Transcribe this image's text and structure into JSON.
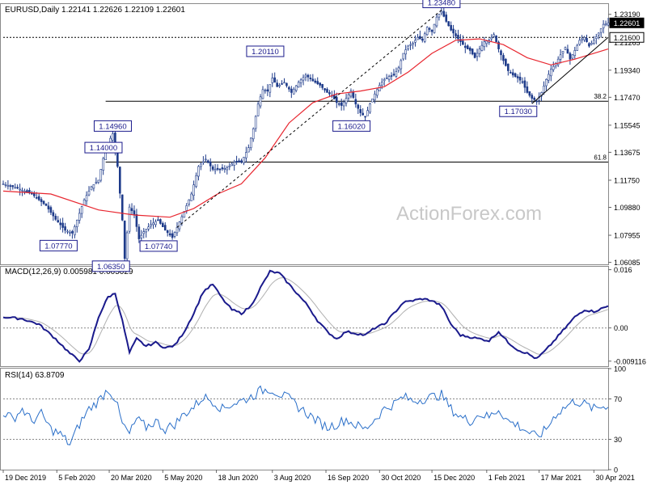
{
  "chart_data": [
    {
      "type": "candlestick",
      "title": "EURUSD,Daily",
      "ohlc_label": "1.22141 1.22626 1.22109 1.22601",
      "ylim": [
        1.0595,
        1.239
      ],
      "yticks": [
        "1.23190",
        "1.21265",
        "1.19340",
        "1.17470",
        "1.15545",
        "1.13675",
        "1.11750",
        "1.09880",
        "1.07955",
        "1.06085"
      ],
      "price_badges": [
        {
          "label": "1.22601",
          "value": 1.22601,
          "style": "dark"
        },
        {
          "label": "1.21600",
          "value": 1.216,
          "style": "light"
        }
      ],
      "price_path": [
        [
          0,
          1.115
        ],
        [
          6,
          1.112
        ],
        [
          12,
          1.108
        ],
        [
          18,
          1.1
        ],
        [
          22,
          1.0905
        ],
        [
          26,
          1.083
        ],
        [
          29,
          1.081
        ],
        [
          31,
          1.09
        ],
        [
          34,
          1.104
        ],
        [
          37,
          1.113
        ],
        [
          40,
          1.1175
        ],
        [
          43,
          1.14
        ],
        [
          46,
          1.1496
        ],
        [
          48,
          1.127
        ],
        [
          50,
          1.09
        ],
        [
          51,
          1.0635
        ],
        [
          53,
          1.099
        ],
        [
          55,
          1.094
        ],
        [
          57,
          1.077
        ],
        [
          59,
          1.082
        ],
        [
          62,
          1.087
        ],
        [
          65,
          1.09
        ],
        [
          68,
          1.083
        ],
        [
          71,
          1.078
        ],
        [
          73,
          1.085
        ],
        [
          76,
          1.096
        ],
        [
          79,
          1.108
        ],
        [
          82,
          1.127
        ],
        [
          85,
          1.132
        ],
        [
          88,
          1.125
        ],
        [
          91,
          1.125
        ],
        [
          94,
          1.126
        ],
        [
          97,
          1.13
        ],
        [
          100,
          1.13
        ],
        [
          103,
          1.14
        ],
        [
          105,
          1.153
        ],
        [
          107,
          1.17
        ],
        [
          109,
          1.18
        ],
        [
          111,
          1.179
        ],
        [
          113,
          1.188
        ],
        [
          115,
          1.182
        ],
        [
          118,
          1.185
        ],
        [
          121,
          1.178
        ],
        [
          124,
          1.185
        ],
        [
          127,
          1.19
        ],
        [
          130,
          1.186
        ],
        [
          133,
          1.183
        ],
        [
          136,
          1.178
        ],
        [
          138,
          1.176
        ],
        [
          140,
          1.171
        ],
        [
          142,
          1.169
        ],
        [
          144,
          1.174
        ],
        [
          146,
          1.179
        ],
        [
          148,
          1.17
        ],
        [
          150,
          1.164
        ],
        [
          152,
          1.161
        ],
        [
          154,
          1.1702
        ],
        [
          156,
          1.177
        ],
        [
          158,
          1.183
        ],
        [
          160,
          1.187
        ],
        [
          162,
          1.189
        ],
        [
          164,
          1.19
        ],
        [
          166,
          1.195
        ],
        [
          168,
          1.205
        ],
        [
          170,
          1.21
        ],
        [
          172,
          1.212
        ],
        [
          174,
          1.216
        ],
        [
          176,
          1.214
        ],
        [
          178,
          1.223
        ],
        [
          180,
          1.22
        ],
        [
          182,
          1.23
        ],
        [
          184,
          1.234
        ],
        [
          186,
          1.227
        ],
        [
          188,
          1.221
        ],
        [
          190,
          1.217
        ],
        [
          192,
          1.213
        ],
        [
          194,
          1.209
        ],
        [
          196,
          1.207
        ],
        [
          198,
          1.202
        ],
        [
          200,
          1.208
        ],
        [
          202,
          1.213
        ],
        [
          204,
          1.214
        ],
        [
          206,
          1.218
        ],
        [
          208,
          1.208
        ],
        [
          210,
          1.2
        ],
        [
          212,
          1.193
        ],
        [
          214,
          1.19
        ],
        [
          216,
          1.188
        ],
        [
          218,
          1.185
        ],
        [
          220,
          1.178
        ],
        [
          222,
          1.174
        ],
        [
          224,
          1.172
        ],
        [
          226,
          1.178
        ],
        [
          228,
          1.187
        ],
        [
          230,
          1.194
        ],
        [
          232,
          1.198
        ],
        [
          234,
          1.204
        ],
        [
          236,
          1.209
        ],
        [
          238,
          1.201
        ],
        [
          240,
          1.207
        ],
        [
          242,
          1.214
        ],
        [
          244,
          1.216
        ],
        [
          246,
          1.21
        ],
        [
          248,
          1.214
        ],
        [
          250,
          1.219
        ],
        [
          252,
          1.225
        ],
        [
          254,
          1.226
        ]
      ],
      "sma_path": [
        [
          0,
          1.11
        ],
        [
          20,
          1.108
        ],
        [
          40,
          1.097
        ],
        [
          55,
          1.0935
        ],
        [
          70,
          1.092
        ],
        [
          80,
          1.098
        ],
        [
          90,
          1.108
        ],
        [
          100,
          1.115
        ],
        [
          110,
          1.133
        ],
        [
          120,
          1.157
        ],
        [
          130,
          1.171
        ],
        [
          140,
          1.177
        ],
        [
          150,
          1.179
        ],
        [
          160,
          1.182
        ],
        [
          170,
          1.192
        ],
        [
          180,
          1.205
        ],
        [
          190,
          1.214
        ],
        [
          200,
          1.215
        ],
        [
          210,
          1.211
        ],
        [
          220,
          1.202
        ],
        [
          230,
          1.197
        ],
        [
          240,
          1.201
        ],
        [
          254,
          1.208
        ]
      ],
      "sma_color": "#e8262f",
      "candle_color": "#1e3b8a",
      "fib_levels": [
        {
          "label": "38.2",
          "value": 1.172,
          "x_from": 43
        },
        {
          "label": "61.8",
          "value": 1.13,
          "x_from": 43
        }
      ],
      "resistance_level": 1.216,
      "trendlines": [
        {
          "from": [
            73,
            1.085
          ],
          "to": [
            184,
            1.2348
          ],
          "dashed": true,
          "color": "#000000"
        },
        {
          "from": [
            222,
            1.1703
          ],
          "to": [
            254,
            1.216
          ],
          "dashed": false,
          "color": "#000000"
        }
      ],
      "price_labels": [
        {
          "label": "1.23480",
          "x": 184,
          "value": 1.2348,
          "pos": "above"
        },
        {
          "label": "1.20110",
          "x": 110,
          "value": 1.2011,
          "pos": "above"
        },
        {
          "label": "1.16020",
          "x": 152,
          "value": 1.1602,
          "pos": "below"
        },
        {
          "label": "1.17030",
          "x": 222,
          "value": 1.1703,
          "pos": "below"
        },
        {
          "label": "1.14960",
          "x": 46,
          "value": 1.1496,
          "pos": "above"
        },
        {
          "label": "1.14000",
          "x": 37,
          "value": 1.14,
          "pos": "right"
        },
        {
          "label": "1.07770",
          "x": 29,
          "value": 1.0777,
          "pos": "below"
        },
        {
          "label": "1.07740",
          "x": 71,
          "value": 1.0774,
          "pos": "below"
        },
        {
          "label": "1.06350",
          "x": 51,
          "value": 1.0635,
          "pos": "below"
        }
      ],
      "watermark": "ActionForex.com"
    },
    {
      "type": "line",
      "title": "MACD(12,26,9) 0.005981 0.005029",
      "ylim": [
        -0.0105,
        0.0168
      ],
      "yticks": [
        "0.016",
        "0.00",
        "-0.009116"
      ],
      "zero_label": "0.00",
      "macd_color": "#1a1a8c",
      "signal_color": "#b0b0b0",
      "macd_path": [
        [
          0,
          0.003
        ],
        [
          8,
          0.0025
        ],
        [
          15,
          0.001
        ],
        [
          22,
          -0.003
        ],
        [
          28,
          -0.007
        ],
        [
          32,
          -0.009
        ],
        [
          36,
          -0.006
        ],
        [
          40,
          0.003
        ],
        [
          44,
          0.0085
        ],
        [
          47,
          0.0095
        ],
        [
          50,
          0.002
        ],
        [
          53,
          -0.0068
        ],
        [
          56,
          -0.003
        ],
        [
          60,
          -0.005
        ],
        [
          64,
          -0.004
        ],
        [
          68,
          -0.0055
        ],
        [
          72,
          -0.0048
        ],
        [
          76,
          -0.001
        ],
        [
          80,
          0.004
        ],
        [
          84,
          0.01
        ],
        [
          88,
          0.012
        ],
        [
          92,
          0.008
        ],
        [
          96,
          0.005
        ],
        [
          100,
          0.004
        ],
        [
          104,
          0.006
        ],
        [
          108,
          0.011
        ],
        [
          112,
          0.0155
        ],
        [
          116,
          0.015
        ],
        [
          120,
          0.012
        ],
        [
          124,
          0.009
        ],
        [
          128,
          0.006
        ],
        [
          132,
          0.002
        ],
        [
          136,
          -0.001
        ],
        [
          140,
          -0.003
        ],
        [
          144,
          -0.001
        ],
        [
          148,
          -0.0015
        ],
        [
          152,
          -0.002
        ],
        [
          156,
          0.0
        ],
        [
          160,
          0.001
        ],
        [
          164,
          0.004
        ],
        [
          168,
          0.007
        ],
        [
          172,
          0.0075
        ],
        [
          176,
          0.008
        ],
        [
          180,
          0.0075
        ],
        [
          184,
          0.006
        ],
        [
          188,
          0.001
        ],
        [
          192,
          -0.002
        ],
        [
          196,
          -0.0025
        ],
        [
          200,
          -0.003
        ],
        [
          204,
          -0.0035
        ],
        [
          208,
          -0.001
        ],
        [
          212,
          -0.004
        ],
        [
          216,
          -0.006
        ],
        [
          220,
          -0.007
        ],
        [
          224,
          -0.0085
        ],
        [
          228,
          -0.006
        ],
        [
          232,
          -0.003
        ],
        [
          236,
          0.0
        ],
        [
          240,
          0.003
        ],
        [
          244,
          0.005
        ],
        [
          248,
          0.0045
        ],
        [
          252,
          0.0055
        ],
        [
          254,
          0.006
        ]
      ]
    },
    {
      "type": "line",
      "title": "RSI(14) 63.8709",
      "ylim": [
        0,
        100
      ],
      "yticks": [
        "100",
        "70",
        "30",
        "0"
      ],
      "levels": [
        70,
        30
      ],
      "line_color": "#2a6fc9",
      "rsi_path": [
        [
          0,
          57
        ],
        [
          4,
          50
        ],
        [
          8,
          60
        ],
        [
          12,
          48
        ],
        [
          16,
          55
        ],
        [
          20,
          40
        ],
        [
          24,
          35
        ],
        [
          28,
          25
        ],
        [
          32,
          45
        ],
        [
          36,
          60
        ],
        [
          40,
          68
        ],
        [
          44,
          80
        ],
        [
          47,
          70
        ],
        [
          50,
          45
        ],
        [
          53,
          35
        ],
        [
          56,
          50
        ],
        [
          60,
          42
        ],
        [
          64,
          48
        ],
        [
          68,
          40
        ],
        [
          72,
          45
        ],
        [
          76,
          55
        ],
        [
          80,
          62
        ],
        [
          84,
          72
        ],
        [
          88,
          68
        ],
        [
          92,
          60
        ],
        [
          96,
          65
        ],
        [
          100,
          68
        ],
        [
          104,
          72
        ],
        [
          108,
          78
        ],
        [
          112,
          80
        ],
        [
          116,
          75
        ],
        [
          120,
          70
        ],
        [
          124,
          62
        ],
        [
          128,
          55
        ],
        [
          132,
          48
        ],
        [
          136,
          42
        ],
        [
          140,
          45
        ],
        [
          144,
          50
        ],
        [
          148,
          44
        ],
        [
          152,
          40
        ],
        [
          156,
          50
        ],
        [
          160,
          60
        ],
        [
          164,
          65
        ],
        [
          168,
          72
        ],
        [
          172,
          68
        ],
        [
          176,
          70
        ],
        [
          180,
          72
        ],
        [
          184,
          74
        ],
        [
          188,
          60
        ],
        [
          192,
          52
        ],
        [
          196,
          48
        ],
        [
          200,
          55
        ],
        [
          204,
          52
        ],
        [
          208,
          60
        ],
        [
          212,
          48
        ],
        [
          216,
          44
        ],
        [
          220,
          38
        ],
        [
          224,
          32
        ],
        [
          228,
          40
        ],
        [
          232,
          55
        ],
        [
          236,
          62
        ],
        [
          240,
          68
        ],
        [
          244,
          65
        ],
        [
          248,
          60
        ],
        [
          252,
          63
        ],
        [
          254,
          64
        ]
      ]
    }
  ],
  "x_axis": {
    "labels": [
      "19 Dec 2019",
      "5 Feb 2020",
      "20 Mar 2020",
      "5 May 2020",
      "18 Jun 2020",
      "3 Aug 2020",
      "16 Sep 2020",
      "30 Oct 2020",
      "15 Dec 2020",
      "1 Feb 2021",
      "17 Mar 2021",
      "30 Apr 2021"
    ],
    "positions": [
      0,
      22.5,
      44.5,
      67,
      89.5,
      113,
      135.5,
      158,
      180,
      203,
      225,
      248
    ]
  }
}
